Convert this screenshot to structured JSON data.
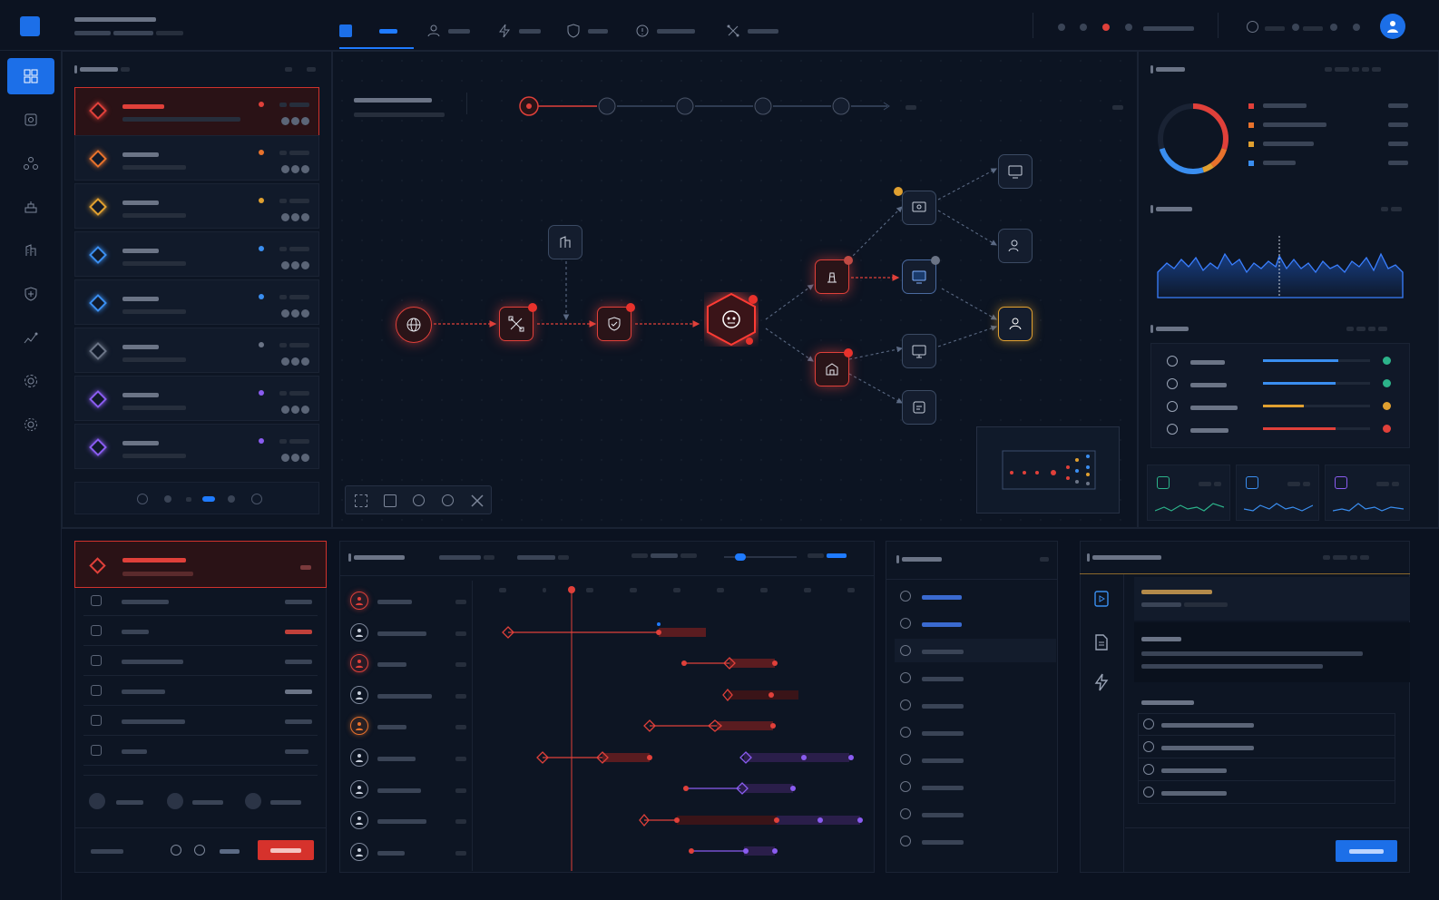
{
  "theme": {
    "accent": "#1c6fe8",
    "danger": "#e0403a",
    "warning": "#e0a030",
    "info": "#3a8ef0",
    "success": "#2cb38a",
    "violet": "#8a5cf0"
  },
  "topbar": {
    "tab_icons": [
      "square-icon",
      "grid-icon",
      "user-icon",
      "bolt-icon",
      "shield-icon",
      "shield-alert-icon",
      "network-icon"
    ],
    "status_dot_colors": [
      "#3a4456",
      "#3a4456",
      "#e0403a",
      "#3a4456"
    ]
  },
  "rail": {
    "items": [
      "dashboard-icon",
      "shield-square-icon",
      "cluster-icon",
      "stack-icon",
      "report-icon",
      "shield-icon",
      "trend-icon",
      "settings-icon",
      "settings-alt-icon"
    ]
  },
  "incidents": [
    {
      "severity": "#e0403a",
      "selected": true
    },
    {
      "severity": "#e8722c",
      "selected": false
    },
    {
      "severity": "#e0a030",
      "selected": false
    },
    {
      "severity": "#3a8ef0",
      "selected": false
    },
    {
      "severity": "#3a8ef0",
      "selected": false
    },
    {
      "severity": "#6b7486",
      "selected": false
    },
    {
      "severity": "#8a5cf0",
      "selected": false
    },
    {
      "severity": "#8a5cf0",
      "selected": false
    }
  ],
  "graph": {
    "nodes": [
      {
        "name": "internet-node-icon",
        "state": "alert"
      },
      {
        "name": "network-node-icon",
        "state": "alert"
      },
      {
        "name": "firewall-node-icon",
        "state": "alert"
      },
      {
        "name": "threat-actor-node-icon",
        "state": "critical"
      },
      {
        "name": "server-node-icon",
        "state": "alert"
      },
      {
        "name": "database-node-icon",
        "state": "alert"
      },
      {
        "name": "workstation-node-icon",
        "state": "normal"
      },
      {
        "name": "user-node-icon",
        "state": "warning"
      }
    ]
  },
  "donut": {
    "segments": [
      {
        "color": "#e0403a",
        "fraction": 0.3
      },
      {
        "color": "#e8722c",
        "fraction": 0.1
      },
      {
        "color": "#e0a030",
        "fraction": 0.05
      },
      {
        "color": "#3a8ef0",
        "fraction": 0.25
      }
    ]
  },
  "posture_bars": [
    {
      "color": "#3a8ef0",
      "fraction": 0.7,
      "status": "#2cb38a"
    },
    {
      "color": "#3a8ef0",
      "fraction": 0.68,
      "status": "#2cb38a"
    },
    {
      "color": "#e0a030",
      "fraction": 0.38,
      "status": "#e0a030"
    },
    {
      "color": "#e0403a",
      "fraction": 0.68,
      "status": "#e0403a"
    }
  ],
  "timeline": {
    "rows": [
      {
        "icon": "threat-icon",
        "color": "#e0403a"
      },
      {
        "icon": "user-icon",
        "color": "#7d879a"
      },
      {
        "icon": "virus-icon",
        "color": "#e0403a"
      },
      {
        "icon": "user-icon",
        "color": "#7d879a"
      },
      {
        "icon": "shield-icon",
        "color": "#e8722c"
      },
      {
        "icon": "user-icon",
        "color": "#7d879a"
      },
      {
        "icon": "user-lock-icon",
        "color": "#7d879a"
      },
      {
        "icon": "user-alert-icon",
        "color": "#7d879a"
      },
      {
        "icon": "user-icon",
        "color": "#7d879a"
      }
    ]
  },
  "checklist_count": 10,
  "actions_count": 4
}
